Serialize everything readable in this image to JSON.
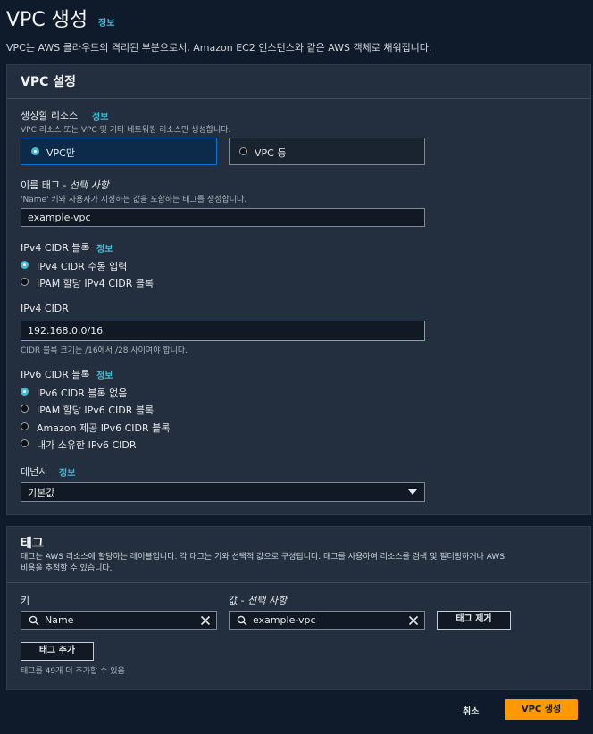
{
  "header": {
    "title": "VPC 생성",
    "info": "정보",
    "subtitle": "VPC는 AWS 클라우드의 격리된 부분으로서, Amazon EC2 인스턴스와 같은 AWS 객체로 채워집니다."
  },
  "vpc_settings": {
    "title": "VPC 설정",
    "resources": {
      "label": "생성할 리소스",
      "info": "정보",
      "description": "VPC 리소스 또는 VPC 및 기타 네트워킹 리소스만 생성합니다.",
      "options": [
        {
          "label": "VPC만",
          "selected": true
        },
        {
          "label": "VPC 등",
          "selected": false
        }
      ]
    },
    "name_tag": {
      "label": "이름 태그 - ",
      "optional": "선택 사항",
      "description": "'Name' 키와 사용자가 지정하는 값을 포함하는 태그를 생성합니다.",
      "value": "example-vpc"
    },
    "ipv4_block": {
      "label": "IPv4 CIDR 블록",
      "info": "정보",
      "options": [
        {
          "label": "IPv4 CIDR 수동 입력",
          "selected": true
        },
        {
          "label": "IPAM 할당 IPv4 CIDR 블록",
          "selected": false
        }
      ]
    },
    "ipv4_cidr": {
      "label": "IPv4 CIDR",
      "value": "192.168.0.0/16",
      "hint": "CIDR 블록 크기는 /16에서 /28 사이여야 합니다."
    },
    "ipv6_block": {
      "label": "IPv6 CIDR 블록",
      "info": "정보",
      "options": [
        {
          "label": "IPv6 CIDR 블록 없음",
          "selected": true
        },
        {
          "label": "IPAM 할당 IPv6 CIDR 블록",
          "selected": false
        },
        {
          "label": "Amazon 제공 IPv6 CIDR 블록",
          "selected": false
        },
        {
          "label": "내가 소유한 IPv6 CIDR",
          "selected": false
        }
      ]
    },
    "tenancy": {
      "label": "테넌시",
      "info": "정보",
      "value": "기본값"
    }
  },
  "tags": {
    "title": "태그",
    "description_line1": "태그는 AWS 리소스에 할당하는 레이블입니다. 각 태그는 키와 선택적 값으로 구성됩니다. 태그를 사용하여 리소스를 검색 및 필터링하거나 AWS",
    "description_line2": "비용을 추적할 수 있습니다.",
    "key_label": "키",
    "value_label": "값 - ",
    "value_optional": "선택 사항",
    "key_value": "Name",
    "value_value": "example-vpc",
    "remove_button": "태그 제거",
    "add_button": "태그 추가",
    "remaining": "태그를 49개 더 추가할 수 있음"
  },
  "footer": {
    "cancel": "취소",
    "create": "VPC 생성"
  },
  "colors": {
    "background": "#0f1b2a",
    "panel": "#232f3e",
    "accent": "#44b9d6",
    "primary": "#ff9900",
    "selected_border": "#0972d3"
  }
}
